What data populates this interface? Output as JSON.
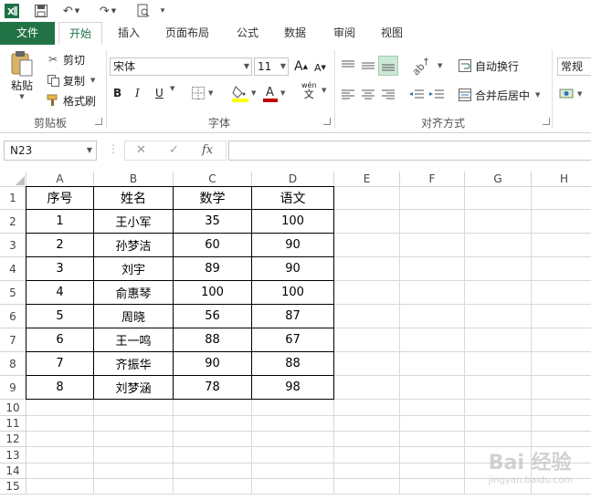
{
  "colors": {
    "accent": "#217346",
    "app_icon_bg": "#1e7145",
    "font_red": "#c00000",
    "fill_yellow": "#ffff00",
    "align_active": "#cde8d6"
  },
  "ribbon_tabs": [
    "文件",
    "开始",
    "插入",
    "页面布局",
    "公式",
    "数据",
    "审阅",
    "视图"
  ],
  "clipboard": {
    "paste": "粘贴",
    "cut": "剪切",
    "copy": "复制",
    "format_painter": "格式刷",
    "group": "剪贴板"
  },
  "font": {
    "name": "宋体",
    "size": "11",
    "group": "字体",
    "bold": "B",
    "italic": "I",
    "underline": "U",
    "grow": "A",
    "shrink": "A",
    "phonetic_top": "wén",
    "phonetic_bottom": "文"
  },
  "alignment": {
    "wrap": "自动换行",
    "merge": "合并后居中",
    "group": "对齐方式"
  },
  "number": {
    "format": "常规"
  },
  "formula_bar": {
    "name_box": "N23",
    "cancel": "✕",
    "enter": "✓",
    "fx": "fx",
    "formula": ""
  },
  "columns": [
    "A",
    "B",
    "C",
    "D",
    "E",
    "F",
    "G",
    "H"
  ],
  "rows": [
    "1",
    "2",
    "3",
    "4",
    "5",
    "6",
    "7",
    "8",
    "9",
    "10",
    "11",
    "12",
    "13",
    "14",
    "15"
  ],
  "table": {
    "headers": [
      "序号",
      "姓名",
      "数学",
      "语文"
    ],
    "rows": [
      [
        "1",
        "王小军",
        "35",
        "100"
      ],
      [
        "2",
        "孙梦洁",
        "60",
        "90"
      ],
      [
        "3",
        "刘宇",
        "89",
        "90"
      ],
      [
        "4",
        "俞惠琴",
        "100",
        "100"
      ],
      [
        "5",
        "周晓",
        "56",
        "87"
      ],
      [
        "6",
        "王一鸣",
        "88",
        "67"
      ],
      [
        "7",
        "齐振华",
        "90",
        "88"
      ],
      [
        "8",
        "刘梦涵",
        "78",
        "98"
      ]
    ]
  },
  "watermark": {
    "brand": "Bai 经验",
    "url": "jingyan.baidu.com"
  }
}
